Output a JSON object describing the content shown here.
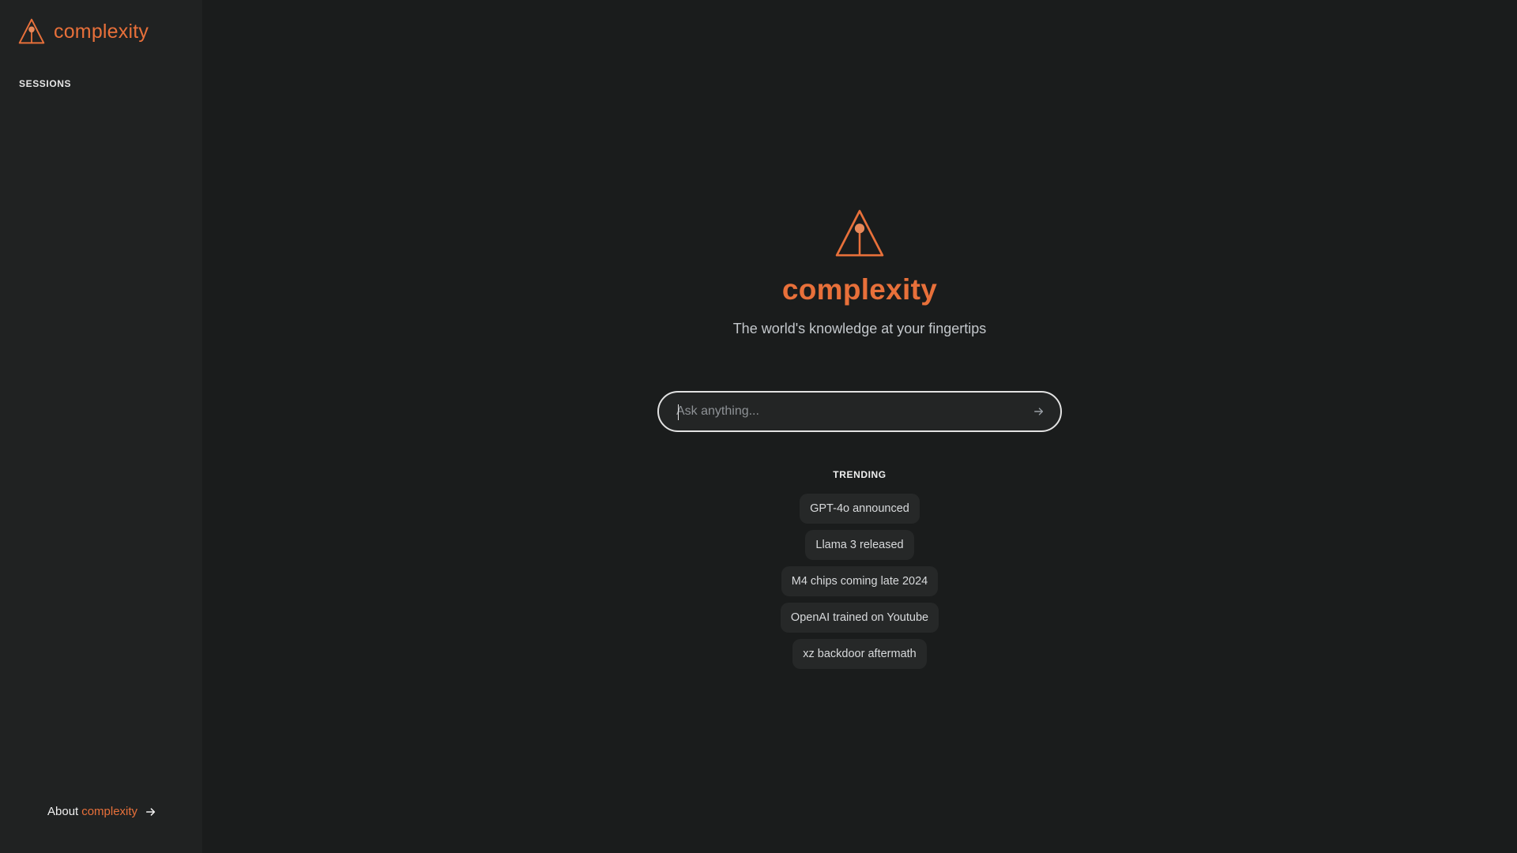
{
  "sidebar": {
    "brand": "complexity",
    "sessions_label": "SESSIONS",
    "about_prefix": "About",
    "about_brand": "complexity"
  },
  "hero": {
    "title": "complexity",
    "subtitle": "The world's knowledge at your fingertips"
  },
  "search": {
    "placeholder": "Ask anything...",
    "value": ""
  },
  "trending": {
    "label": "TRENDING",
    "items": [
      "GPT-4o announced",
      "Llama 3 released",
      "M4 chips coming late 2024",
      "OpenAI trained on Youtube",
      "xz backdoor aftermath"
    ]
  },
  "colors": {
    "accent": "#e8703a",
    "background": "#1a1c1c",
    "sidebar": "#202222",
    "chip": "#262828"
  },
  "icons": {
    "logo": "triangle-logo-icon",
    "submit": "arrow-right-icon",
    "about": "arrow-right-icon"
  }
}
